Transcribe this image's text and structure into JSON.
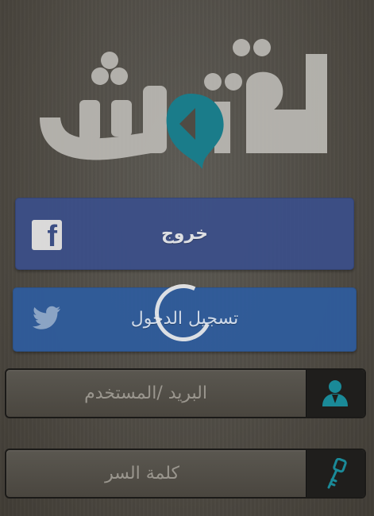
{
  "logo": {
    "text": "فتوش",
    "colors": {
      "gray": "#bdbbb6",
      "teal": "#1a7c8a"
    }
  },
  "facebook": {
    "label": "خروج",
    "icon": "facebook-icon",
    "color": "#3b4f8a"
  },
  "twitter": {
    "label": "تسجيل الدخول",
    "icon": "twitter-icon",
    "color": "#2f5c9c"
  },
  "loading": {
    "icon": "loading-spinner-icon"
  },
  "username": {
    "placeholder": "البريد /المستخدم",
    "icon": "user-icon"
  },
  "password": {
    "placeholder": "كلمة السر",
    "icon": "key-icon"
  },
  "accent": "#1a8a98"
}
